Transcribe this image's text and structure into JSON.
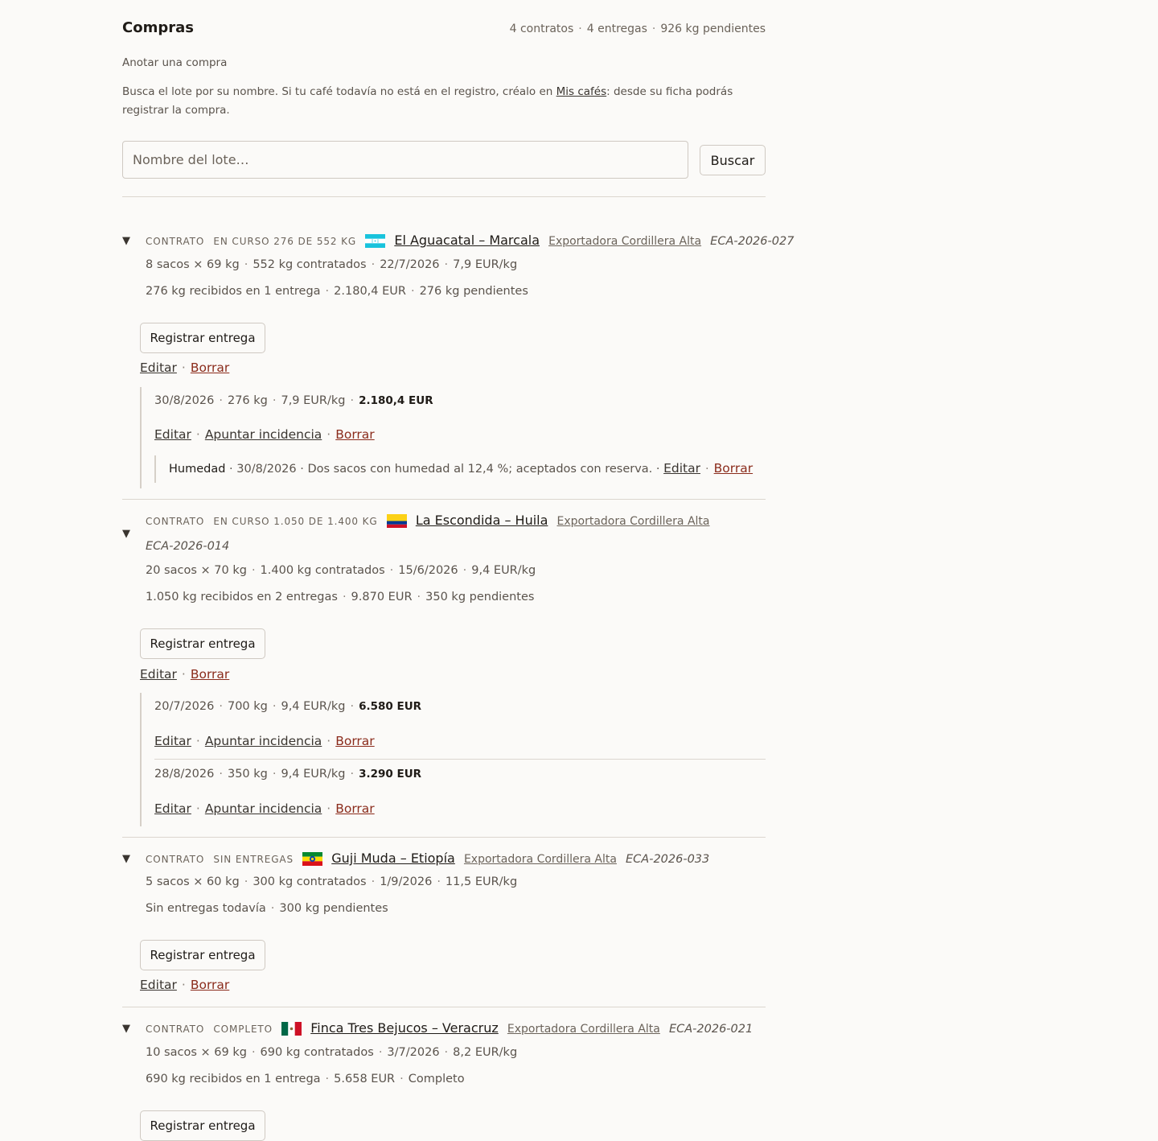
{
  "header": {
    "title": "Compras",
    "contracts_count": "4 contratos",
    "deliveries_count": "4 entregas",
    "pending_kg": "926 kg pendientes"
  },
  "add_purchase": {
    "title": "Anotar una compra",
    "help_before": "Busca el lote por su nombre. Si tu café todavía no está en el registro, créalo en ",
    "help_link": "Mis cafés",
    "help_after": ": desde su ficha podrás registrar la compra.",
    "search_placeholder": "Nombre del lote…",
    "search_button": "Buscar"
  },
  "labels": {
    "contract": "CONTRATO",
    "register_delivery": "Registrar entrega",
    "edit": "Editar",
    "delete": "Borrar",
    "report_incident": "Apuntar incidencia"
  },
  "contracts": [
    {
      "status": "EN CURSO 276 DE 552 KG",
      "flag": "honduras-flag-icon",
      "lot": "El Aguacatal – Marcala",
      "exporter": "Exportadora Cordillera Alta",
      "ref": "ECA-2026-027",
      "bags": "8 sacos × 69 kg",
      "contracted": "552 kg contratados",
      "date": "22/7/2026",
      "price": "7,9 EUR/kg",
      "received": "276 kg recibidos en 1 entrega",
      "amount": "2.180,4 EUR",
      "pending": "276 kg pendientes",
      "deliveries": [
        {
          "date": "30/8/2026",
          "kg": "276 kg",
          "price": "7,9 EUR/kg",
          "total": "2.180,4 EUR",
          "incidents": [
            {
              "type": "Humedad",
              "date": "30/8/2026",
              "text": "Dos sacos con humedad al 12,4 %; aceptados con reserva."
            }
          ]
        }
      ]
    },
    {
      "status": "EN CURSO 1.050 DE 1.400 KG",
      "flag": "colombia-flag-icon",
      "lot": "La Escondida – Huila",
      "exporter": "Exportadora Cordillera Alta",
      "ref": "ECA-2026-014",
      "bags": "20 sacos × 70 kg",
      "contracted": "1.400 kg contratados",
      "date": "15/6/2026",
      "price": "9,4 EUR/kg",
      "received": "1.050 kg recibidos en 2 entregas",
      "amount": "9.870 EUR",
      "pending": "350 kg pendientes",
      "deliveries": [
        {
          "date": "20/7/2026",
          "kg": "700 kg",
          "price": "9,4 EUR/kg",
          "total": "6.580 EUR"
        },
        {
          "date": "28/8/2026",
          "kg": "350 kg",
          "price": "9,4 EUR/kg",
          "total": "3.290 EUR"
        }
      ]
    },
    {
      "status": "SIN ENTREGAS",
      "flag": "ethiopia-flag-icon",
      "lot": "Guji Muda – Etiopía",
      "exporter": "Exportadora Cordillera Alta",
      "ref": "ECA-2026-033",
      "bags": "5 sacos × 60 kg",
      "contracted": "300 kg contratados",
      "date": "1/9/2026",
      "price": "11,5 EUR/kg",
      "received": "Sin entregas todavía",
      "pending": "300 kg pendientes"
    },
    {
      "status": "COMPLETO",
      "flag": "mexico-flag-icon",
      "lot": "Finca Tres Bejucos – Veracruz",
      "exporter": "Exportadora Cordillera Alta",
      "ref": "ECA-2026-021",
      "bags": "10 sacos × 69 kg",
      "contracted": "690 kg contratados",
      "date": "3/7/2026",
      "price": "8,2 EUR/kg",
      "received": "690 kg recibidos en 1 entrega",
      "amount": "5.658 EUR",
      "pending": "Completo"
    }
  ]
}
